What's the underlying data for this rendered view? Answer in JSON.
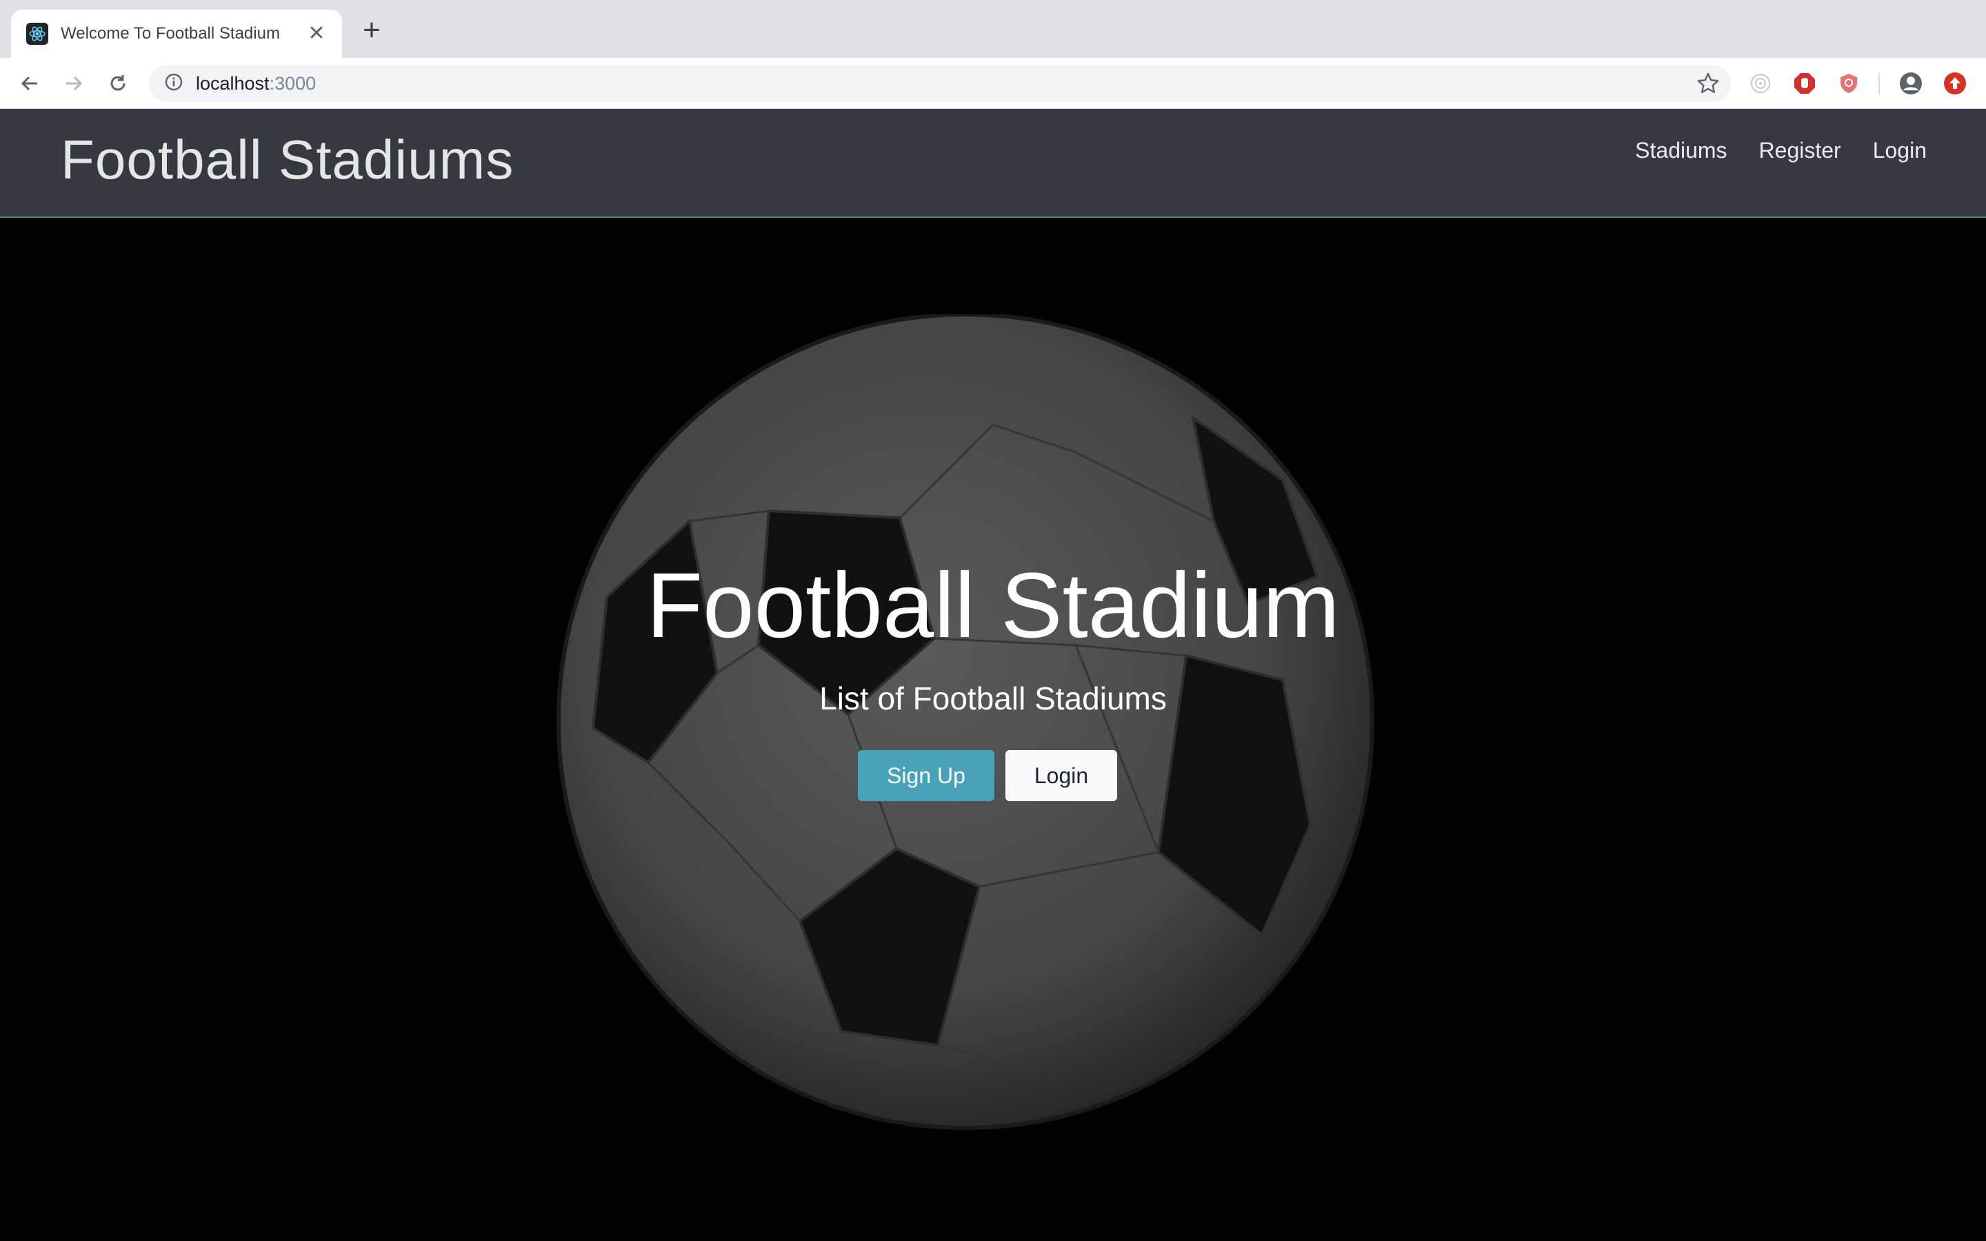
{
  "browser": {
    "tab_title": "Welcome To Football Stadium",
    "tab_close": "✕",
    "new_tab": "+",
    "url_host": "localhost",
    "url_port": ":3000"
  },
  "navbar": {
    "brand": "Football Stadiums",
    "links": [
      "Stadiums",
      "Register",
      "Login"
    ]
  },
  "hero": {
    "title": "Football Stadium",
    "subtitle": "List of Football Stadiums",
    "signup_label": "Sign Up",
    "login_label": "Login"
  },
  "colors": {
    "navbar_bg": "#343a40",
    "accent_button": "#48a2b8",
    "hero_bg": "#020202"
  }
}
